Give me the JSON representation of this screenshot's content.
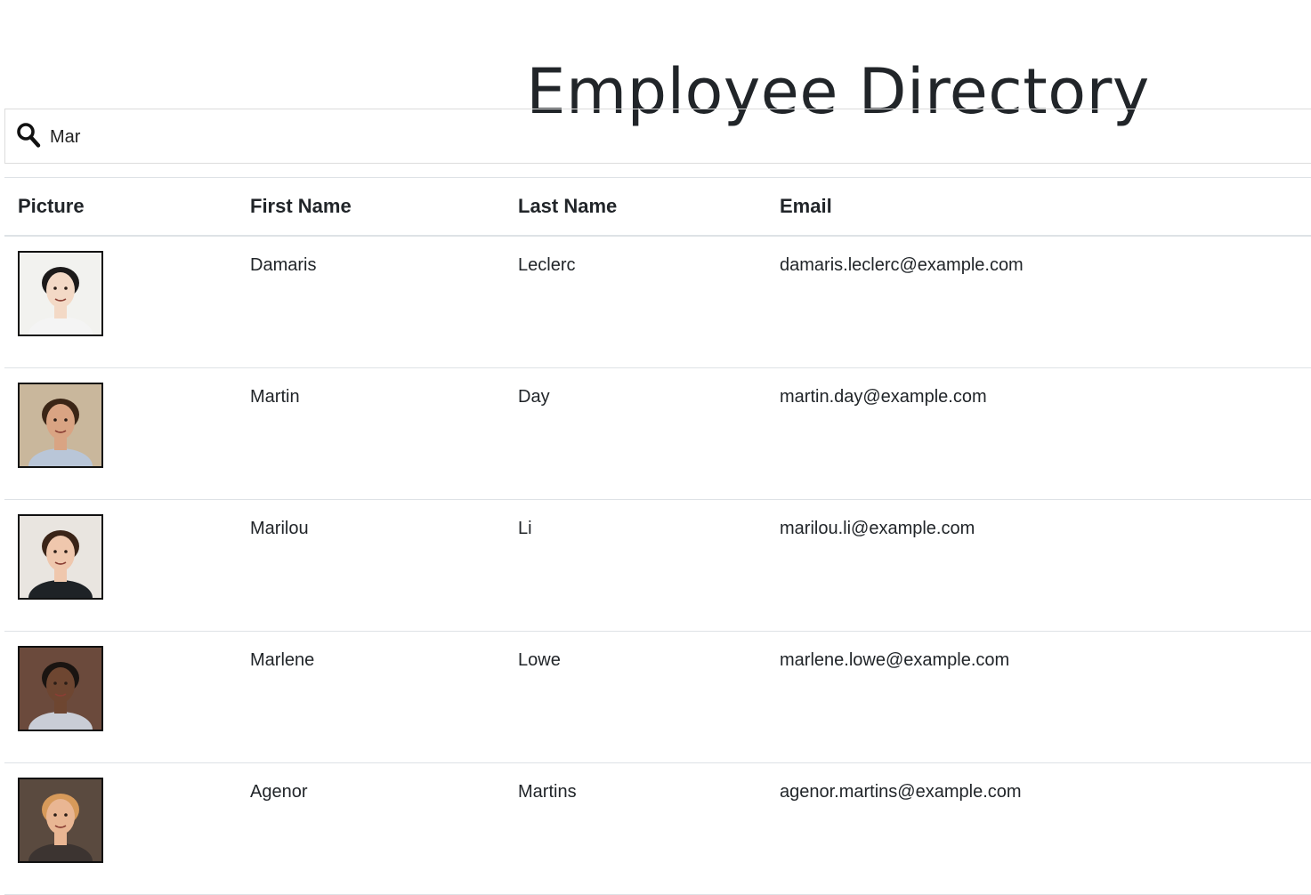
{
  "header": {
    "title": "Employee Directory"
  },
  "search": {
    "value": "Mar",
    "icon": "search-icon"
  },
  "table": {
    "columns": [
      "Picture",
      "First Name",
      "Last Name",
      "Email"
    ],
    "rows": [
      {
        "first": "Damaris",
        "last": "Leclerc",
        "email": "damaris.leclerc@example.com",
        "photo": {
          "bg": "#f2f2ef",
          "skin": "#f3d9c6",
          "hair": "#1c1a1a",
          "shirt": "#f4f4f4"
        }
      },
      {
        "first": "Martin",
        "last": "Day",
        "email": "martin.day@example.com",
        "photo": {
          "bg": "#c9b79c",
          "skin": "#d9a483",
          "hair": "#3a2516",
          "shirt": "#b9c6d8"
        }
      },
      {
        "first": "Marilou",
        "last": "Li",
        "email": "marilou.li@example.com",
        "photo": {
          "bg": "#e9e5e0",
          "skin": "#efc7ad",
          "hair": "#3a2418",
          "shirt": "#1e2226"
        }
      },
      {
        "first": "Marlene",
        "last": "Lowe",
        "email": "marlene.lowe@example.com",
        "photo": {
          "bg": "#6b4a3c",
          "skin": "#6e4631",
          "hair": "#1a1411",
          "shirt": "#c9cdd6"
        }
      },
      {
        "first": "Agenor",
        "last": "Martins",
        "email": "agenor.martins@example.com",
        "photo": {
          "bg": "#5a4a3f",
          "skin": "#e9b693",
          "hair": "#d79a5a",
          "shirt": "#3c3431"
        }
      }
    ]
  }
}
